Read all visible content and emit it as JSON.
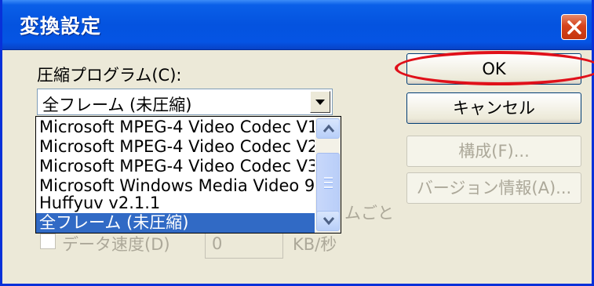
{
  "window": {
    "title": "変換設定"
  },
  "compressor": {
    "label": "圧縮プログラム(C):",
    "selected": "全フレーム (未圧縮)",
    "options": [
      "Microsoft MPEG-4 Video Codec V1",
      "Microsoft MPEG-4 Video Codec V2",
      "Microsoft MPEG-4 Video Codec V3",
      "Microsoft Windows Media Video 9",
      "Huffyuv v2.1.1",
      "全フレーム (未圧縮)"
    ],
    "selected_index": 5
  },
  "buttons": {
    "ok": "OK",
    "cancel": "キャンセル",
    "configure": "構成(F)...",
    "about": "バージョン情報(A)..."
  },
  "behind": {
    "keyframe_suffix": "ムごと",
    "data_rate_label": "データ速度(D)",
    "data_rate_value": "0",
    "data_rate_unit": "KB/秒"
  },
  "colors": {
    "highlight": "#E0101A",
    "selection": "#316AC5"
  },
  "icons": [
    "close-icon",
    "chevron-down-icon",
    "scroll-up-icon",
    "scroll-down-icon"
  ]
}
